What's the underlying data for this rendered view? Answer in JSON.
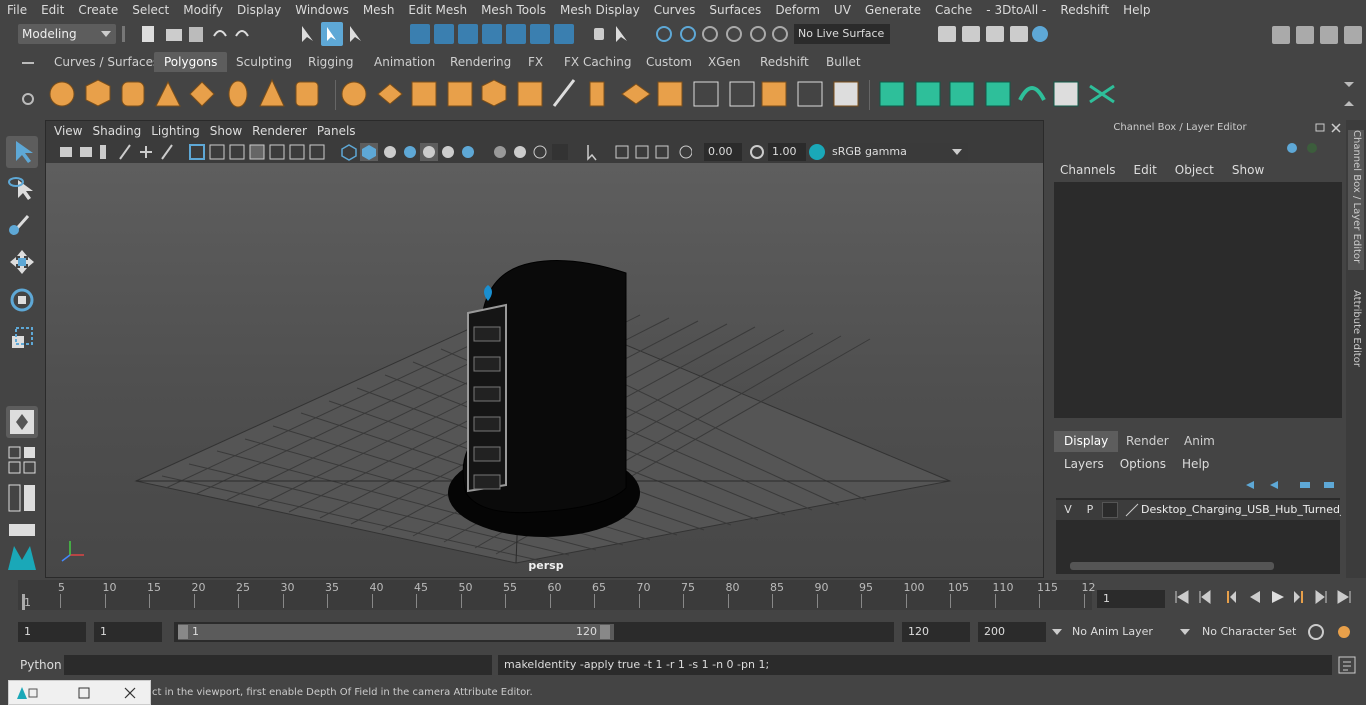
{
  "menubar": {
    "items": [
      "File",
      "Edit",
      "Create",
      "Select",
      "Modify",
      "Display",
      "Windows",
      "Mesh",
      "Edit Mesh",
      "Mesh Tools",
      "Mesh Display",
      "Curves",
      "Surfaces",
      "Deform",
      "UV",
      "Generate",
      "Cache",
      "- 3DtoAll -",
      "Redshift",
      "Help"
    ]
  },
  "status": {
    "mode": "Modeling",
    "live_surface": "No Live Surface"
  },
  "shelf": {
    "tabs": [
      "Curves / Surfaces",
      "Polygons",
      "Sculpting",
      "Rigging",
      "Animation",
      "Rendering",
      "FX",
      "FX Caching",
      "Custom",
      "XGen",
      "Redshift",
      "Bullet"
    ],
    "active": "Polygons"
  },
  "viewport": {
    "menu": [
      "View",
      "Shading",
      "Lighting",
      "Show",
      "Renderer",
      "Panels"
    ],
    "exposure": "0.00",
    "gamma": "1.00",
    "color_space": "sRGB gamma",
    "camera_label": "persp"
  },
  "right_panel": {
    "title": "Channel Box / Layer Editor",
    "channel_menu": [
      "Channels",
      "Edit",
      "Object",
      "Show"
    ],
    "layer_tabs": [
      "Display",
      "Render",
      "Anim"
    ],
    "active_layer_tab": "Display",
    "layer_menu": [
      "Layers",
      "Options",
      "Help"
    ],
    "layer": {
      "v": "V",
      "p": "P",
      "name": "Desktop_Charging_USB_Hub_Turned_Off"
    },
    "side_tabs": [
      "Channel Box / Layer Editor",
      "Attribute Editor"
    ]
  },
  "timeline": {
    "ticks": [
      "5",
      "10",
      "15",
      "20",
      "25",
      "30",
      "35",
      "40",
      "45",
      "50",
      "55",
      "60",
      "65",
      "70",
      "75",
      "80",
      "85",
      "90",
      "95",
      "100",
      "105",
      "110",
      "115",
      "12"
    ],
    "start_label": "1",
    "current_frame": "1"
  },
  "range": {
    "start": "1",
    "playback_start": "1",
    "slider_start": "1",
    "slider_end": "120",
    "playback_end": "120",
    "end": "200",
    "anim_layer": "No Anim Layer",
    "character_set": "No Character Set"
  },
  "command": {
    "language": "Python",
    "result": "makeIdentity -apply true -t 1 -r 1 -s 1 -n 0 -pn 1;"
  },
  "help_line": {
    "text": "ct in the viewport, first enable Depth Of Field in the camera Attribute Editor."
  },
  "colors": {
    "accent": "#5ea8d6",
    "shelf_icon": "#e8a04a",
    "shelf_green": "#2ebf9a"
  }
}
